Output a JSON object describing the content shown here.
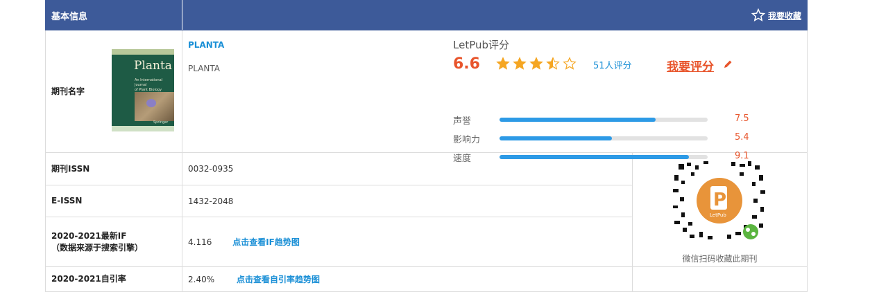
{
  "header": {
    "title": "基本信息",
    "favorite_label": "我要收藏",
    "favorite_icon": "star-outline-icon"
  },
  "journal": {
    "label": "期刊名字",
    "name_link": "PLANTA",
    "abbr": "PLANTA",
    "cover": {
      "title": "Planta",
      "subtitle_lines": [
        "An International Journal",
        "of Plant Biology"
      ],
      "publisher": "Springer"
    }
  },
  "score": {
    "title": "LetPub评分",
    "value": "6.6",
    "stars": 3.5,
    "star_total": 5,
    "count_label": "51人评分",
    "rate_label": "我要评分",
    "metrics": [
      {
        "name": "声誉",
        "value": "7.5",
        "fraction": 0.75
      },
      {
        "name": "影响力",
        "value": "5.4",
        "fraction": 0.54
      },
      {
        "name": "速度",
        "value": "9.1",
        "fraction": 0.91
      }
    ],
    "accent": "#e8552c",
    "bar_color": "#2d9ae6"
  },
  "rows": {
    "issn_label": "期刊ISSN",
    "issn_value": "0032-0935",
    "eissn_label": "E-ISSN",
    "eissn_value": "1432-2048",
    "if_label_line1": "2020-2021最新IF",
    "if_label_line2": "（数据来源于搜索引擎）",
    "if_value": "4.116",
    "if_link": "点击查看IF趋势图",
    "self_label": "2020-2021自引率",
    "self_value": "2.40%",
    "self_link": "点击查看自引率趋势图"
  },
  "qr": {
    "caption": "微信扫码收藏此期刊",
    "center_text": "LetPub"
  }
}
